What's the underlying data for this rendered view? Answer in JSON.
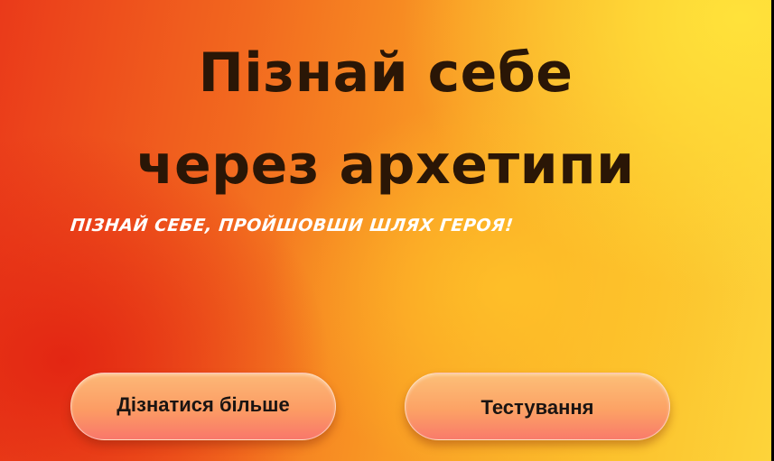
{
  "hero": {
    "title_line1": "Пізнай себе",
    "title_line2": "через архетипи",
    "tagline": "ПІЗНАЙ СЕБЕ, ПРОЙШОВШИ ШЛЯХ ГЕРОЯ!"
  },
  "buttons": {
    "learn_more": "Дізнатися більше",
    "testing": "Тестування"
  },
  "colors": {
    "title": "#2a1606",
    "tagline": "#ffffff",
    "gradient_red": "#e2241a",
    "gradient_yellow": "#fde23a",
    "button_top": "#fcb877",
    "button_bottom": "#f9776a"
  }
}
